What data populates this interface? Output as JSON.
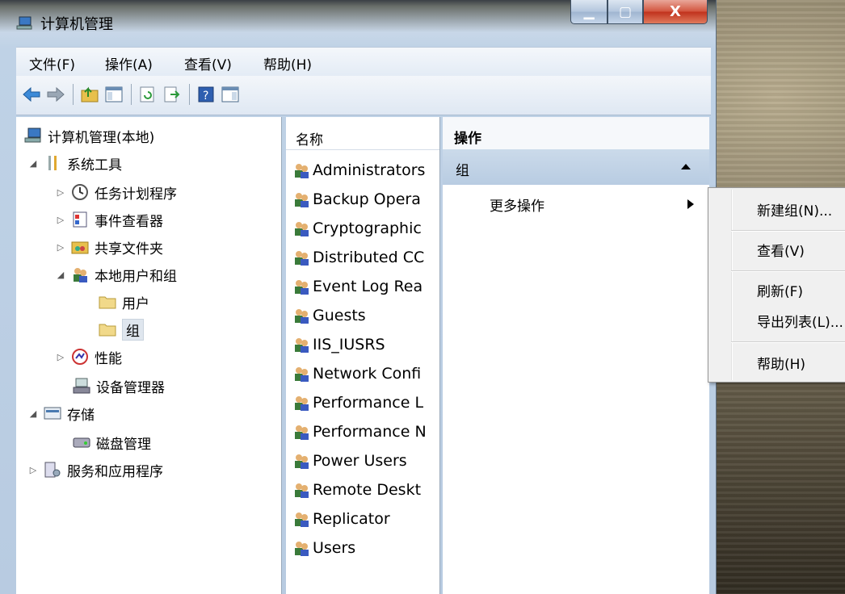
{
  "window": {
    "title": "计算机管理"
  },
  "caption": {
    "minimize": "▁",
    "maximize": "▢",
    "close": "X"
  },
  "menu": [
    "文件(F)",
    "操作(A)",
    "查看(V)",
    "帮助(H)"
  ],
  "tree": [
    {
      "label": "计算机管理(本地)",
      "icon": "computer-management-icon",
      "expander": ""
    },
    {
      "label": "系统工具",
      "icon": "tools-icon",
      "expander": "◢"
    },
    {
      "label": "任务计划程序",
      "icon": "clock-icon",
      "expander": "▷"
    },
    {
      "label": "事件查看器",
      "icon": "event-viewer-icon",
      "expander": "▷"
    },
    {
      "label": "共享文件夹",
      "icon": "shared-folder-icon",
      "expander": "▷"
    },
    {
      "label": "本地用户和组",
      "icon": "users-icon",
      "expander": "◢"
    },
    {
      "label": "用户",
      "icon": "folder-icon",
      "expander": ""
    },
    {
      "label": "组",
      "icon": "folder-icon",
      "expander": ""
    },
    {
      "label": "性能",
      "icon": "performance-icon",
      "expander": "▷"
    },
    {
      "label": "设备管理器",
      "icon": "device-manager-icon",
      "expander": ""
    },
    {
      "label": "存储",
      "icon": "storage-icon",
      "expander": "◢"
    },
    {
      "label": "磁盘管理",
      "icon": "disk-icon",
      "expander": ""
    },
    {
      "label": "服务和应用程序",
      "icon": "services-icon",
      "expander": "▷"
    }
  ],
  "list": {
    "header": "名称",
    "items": [
      "Administrators",
      "Backup Opera",
      "Cryptographic",
      "Distributed CC",
      "Event Log Rea",
      "Guests",
      "IIS_IUSRS",
      "Network Confi",
      "Performance L",
      "Performance N",
      "Power Users",
      "Remote Deskt",
      "Replicator",
      "Users"
    ]
  },
  "actions": {
    "header": "操作",
    "section": "组",
    "more": "更多操作"
  },
  "context_menu": [
    "新建组(N)...",
    "查看(V)",
    "刷新(F)",
    "导出列表(L)...",
    "帮助(H)"
  ]
}
